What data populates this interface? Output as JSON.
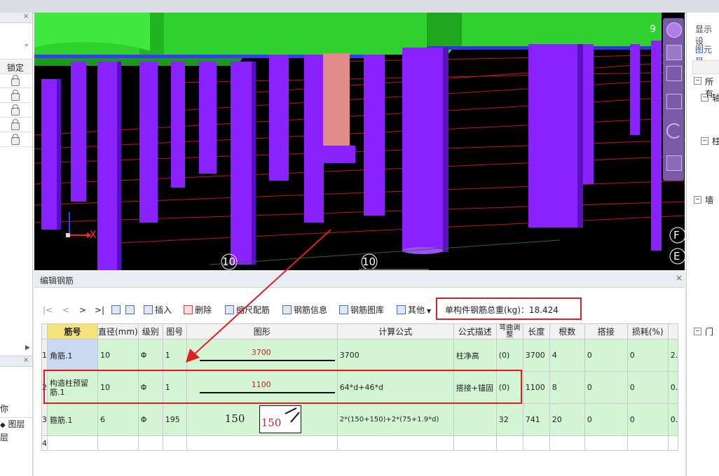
{
  "left_panel": {
    "lock_header": "锁定",
    "lock_rows": 5,
    "bottom_labels": [
      "你",
      "图层",
      "层"
    ]
  },
  "viewport": {
    "axis_labels": [
      "10",
      "10"
    ],
    "right_labels": [
      "F",
      "E"
    ],
    "top_right_number": "9",
    "axis_x": "X"
  },
  "right_panel": {
    "tab1": "显示设",
    "tab2": "图元显",
    "item_all": "所有",
    "items": [
      "轴",
      "柱",
      "墙",
      "门"
    ]
  },
  "editor": {
    "title": "编辑钢筋",
    "toolbar": {
      "insert": "插入",
      "delete": "删除",
      "scale": "缩尺配筋",
      "info": "钢筋信息",
      "library": "钢筋图库",
      "other": "其他",
      "total_weight": "单构件钢筋总重(kg)：18.424"
    },
    "columns": [
      "筋号",
      "直径(mm)",
      "级别",
      "图号",
      "图形",
      "计算公式",
      "公式描述",
      "弯曲调整",
      "长度",
      "根数",
      "搭接",
      "损耗(%)",
      ""
    ],
    "rows": [
      {
        "num": "1",
        "name": "角筋.1",
        "dia": "10",
        "grade": "Φ",
        "fig": "1",
        "shape": "3700",
        "formula": "3700",
        "desc": "柱净高",
        "bend": "(0)",
        "len": "3700",
        "count": "4",
        "lap": "0",
        "loss": "0",
        "extra": "2."
      },
      {
        "num": "2",
        "name": "构造柱预留筋.1",
        "dia": "10",
        "grade": "Φ",
        "fig": "1",
        "shape": "1100",
        "formula": "64*d+46*d",
        "desc": "搭接+锚固",
        "bend": "(0)",
        "len": "1100",
        "count": "8",
        "lap": "0",
        "loss": "0",
        "extra": "0."
      },
      {
        "num": "3",
        "name": "箍筋.1",
        "dia": "6",
        "grade": "Φ",
        "fig": "195",
        "shape_a": "150",
        "shape_b": "150",
        "formula": "2*(150+150)+2*(75+1.9*d)",
        "desc": "",
        "bend": "32",
        "len": "741",
        "count": "20",
        "lap": "0",
        "loss": "0",
        "extra": "0."
      },
      {
        "num": "4"
      }
    ]
  },
  "colors": {
    "purple": "#8a22ff",
    "green": "#22dd22",
    "row_green": "#d4f5d4",
    "annotation_red": "#e02020"
  }
}
